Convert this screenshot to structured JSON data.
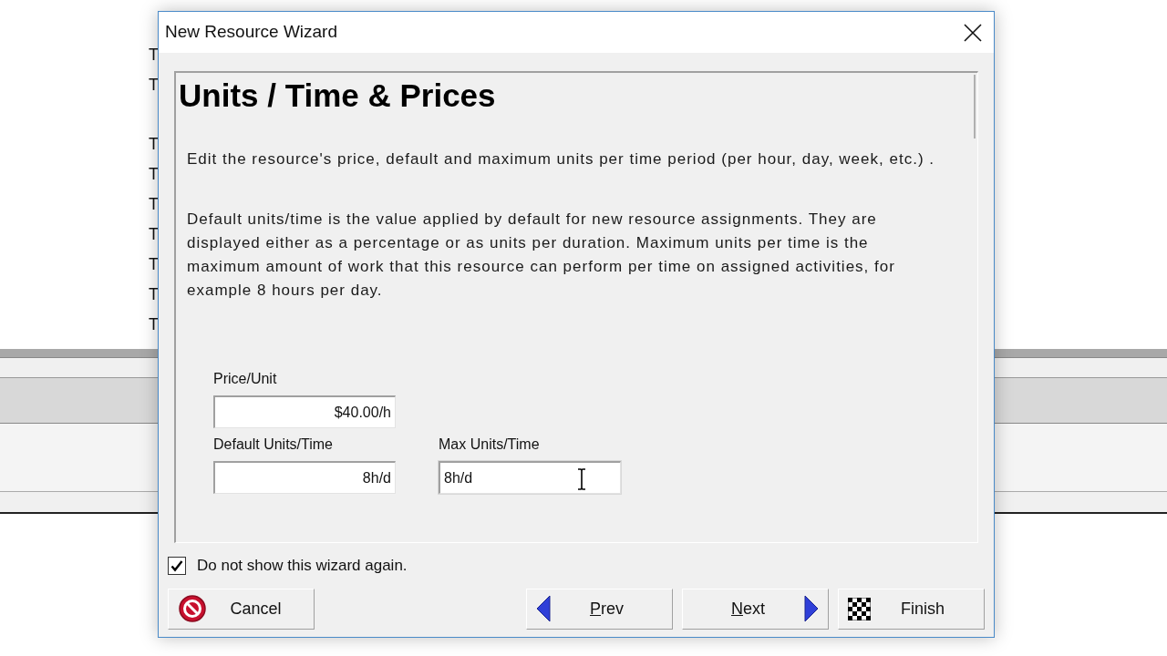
{
  "background_list": [
    "T",
    "T",
    "T",
    "T",
    "T",
    "T",
    "T",
    "T",
    "T"
  ],
  "window": {
    "title": "New Resource Wizard"
  },
  "heading": "Units / Time & Prices",
  "paragraphs": [
    "Edit the resource's price, default and maximum units per time period (per hour, day, week, etc.) .",
    "Default units/time is the value applied by default for new resource assignments.  They are displayed either as a percentage or as units per duration. Maximum units per time is the maximum amount of work that this resource can perform per time on assigned activities, for example 8 hours per day."
  ],
  "fields": {
    "price": {
      "label": "Price/Unit",
      "value": "$40.00/h"
    },
    "default_units": {
      "label": "Default Units/Time",
      "value": "8h/d"
    },
    "max_units": {
      "label": "Max Units/Time",
      "value": "8h/d",
      "focused": true
    }
  },
  "dont_show_again": {
    "label": "Do not show this wizard again.",
    "checked": true
  },
  "buttons": [
    {
      "kind": "cancel",
      "label": "Cancel",
      "underline_first": false
    },
    {
      "kind": "prev",
      "label": "Prev",
      "underline_first": true
    },
    {
      "kind": "next",
      "label": "Next",
      "underline_first": true
    },
    {
      "kind": "finish",
      "label": "Finish",
      "underline_first": false
    }
  ]
}
